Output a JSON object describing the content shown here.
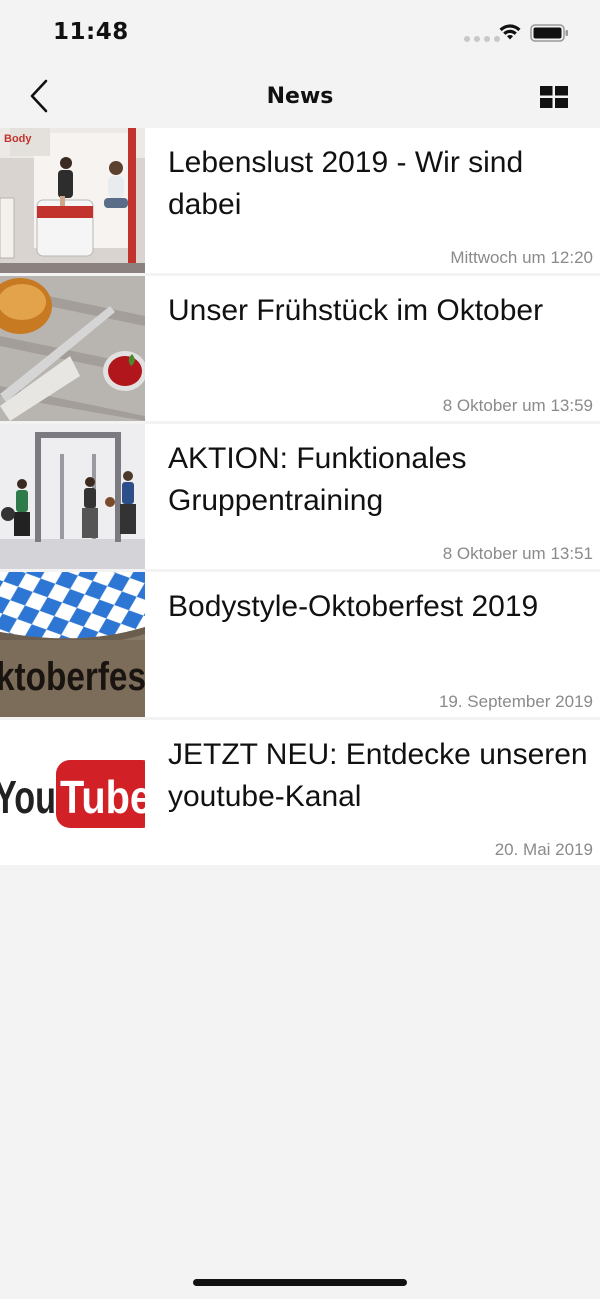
{
  "status_bar": {
    "time": "11:48"
  },
  "nav": {
    "title": "News"
  },
  "news": [
    {
      "title": "Lebenslust 2019 - Wir sind dabei",
      "date": "Mittwoch um 12:20"
    },
    {
      "title": "Unser Frühstück im Oktober",
      "date": "8 Oktober um 13:59"
    },
    {
      "title": "AKTION: Funktionales Gruppentraining",
      "date": "8 Oktober um 13:51"
    },
    {
      "title": "Bodystyle-Oktoberfest 2019",
      "date": "19. September 2019"
    },
    {
      "title": "JETZT NEU: Entdecke unseren youtube-Kanal",
      "date": "20. Mai 2019"
    }
  ],
  "thumb_text": {
    "booth_brand": "Body",
    "oktoberfest": "ktoberfes",
    "youtube_1": "You",
    "youtube_2": "Tube"
  },
  "colors": {
    "background": "#f3f3f3",
    "date_text": "#8a8a8a",
    "youtube_red": "#d22027"
  }
}
